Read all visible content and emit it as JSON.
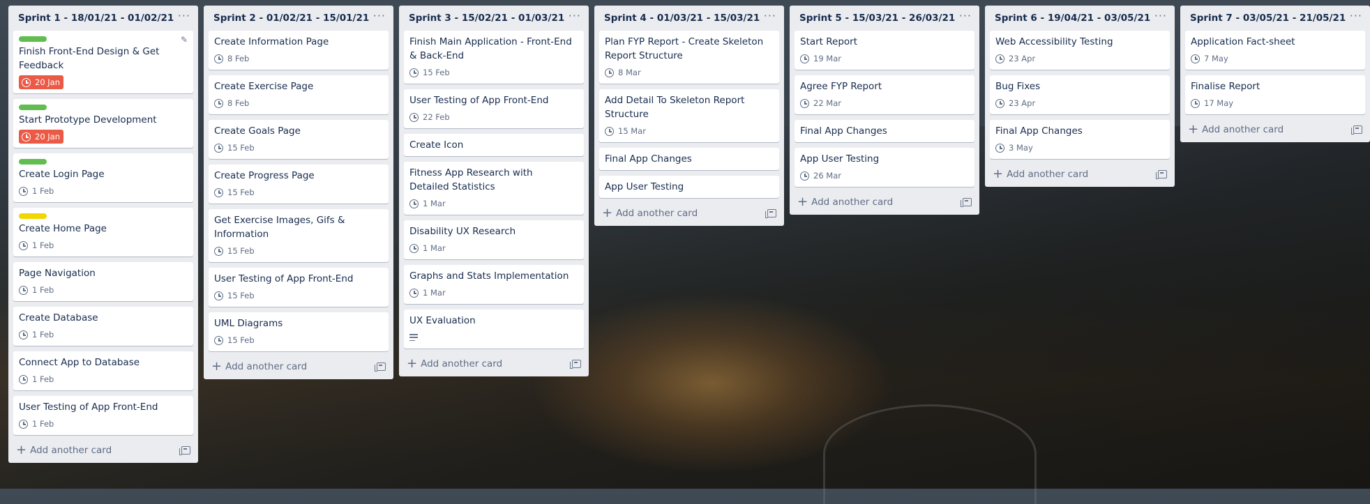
{
  "board": {
    "add_card_label": "Add another card",
    "lists": [
      {
        "title": "Sprint 1 - 18/01/21 - 01/02/21",
        "cards": [
          {
            "title": "Finish Front-End Design & Get Feedback",
            "label_color": "#61bd4f",
            "due": "20 Jan",
            "overdue": true,
            "editing": true
          },
          {
            "title": "Start Prototype Development",
            "label_color": "#61bd4f",
            "due": "20 Jan",
            "overdue": true
          },
          {
            "title": "Create Login Page",
            "label_color": "#61bd4f",
            "due": "1 Feb"
          },
          {
            "title": "Create Home Page",
            "label_color": "#f2d600",
            "due": "1 Feb"
          },
          {
            "title": "Page Navigation",
            "due": "1 Feb"
          },
          {
            "title": "Create Database",
            "due": "1 Feb"
          },
          {
            "title": "Connect App to Database",
            "due": "1 Feb"
          },
          {
            "title": "User Testing of App Front-End",
            "due": "1 Feb"
          }
        ]
      },
      {
        "title": "Sprint 2 - 01/02/21 - 15/01/21",
        "cards": [
          {
            "title": "Create Information Page",
            "due": "8 Feb"
          },
          {
            "title": "Create Exercise Page",
            "due": "8 Feb"
          },
          {
            "title": "Create Goals Page",
            "due": "15 Feb"
          },
          {
            "title": "Create Progress Page",
            "due": "15 Feb"
          },
          {
            "title": "Get Exercise Images, Gifs & Information",
            "due": "15 Feb"
          },
          {
            "title": "User Testing of App Front-End",
            "due": "15 Feb"
          },
          {
            "title": "UML Diagrams",
            "due": "15 Feb"
          }
        ]
      },
      {
        "title": "Sprint 3 - 15/02/21 - 01/03/21",
        "cards": [
          {
            "title": "Finish Main Application - Front-End & Back-End",
            "due": "15 Feb"
          },
          {
            "title": "User Testing of App Front-End",
            "due": "22 Feb"
          },
          {
            "title": "Create Icon"
          },
          {
            "title": "Fitness App Research with Detailed Statistics",
            "due": "1 Mar"
          },
          {
            "title": "Disability UX Research",
            "due": "1 Mar"
          },
          {
            "title": "Graphs and Stats Implementation",
            "due": "1 Mar"
          },
          {
            "title": "UX Evaluation",
            "has_description": true
          }
        ]
      },
      {
        "title": "Sprint 4 - 01/03/21 - 15/03/21",
        "cards": [
          {
            "title": "Plan FYP Report - Create Skeleton Report Structure",
            "due": "8 Mar"
          },
          {
            "title": "Add Detail To Skeleton Report Structure",
            "due": "15 Mar"
          },
          {
            "title": "Final App Changes"
          },
          {
            "title": "App User Testing"
          }
        ]
      },
      {
        "title": "Sprint 5 - 15/03/21 - 26/03/21",
        "cards": [
          {
            "title": "Start Report",
            "due": "19 Mar"
          },
          {
            "title": "Agree FYP Report",
            "due": "22 Mar"
          },
          {
            "title": "Final App Changes"
          },
          {
            "title": "App User Testing",
            "due": "26 Mar"
          }
        ]
      },
      {
        "title": "Sprint 6 - 19/04/21 - 03/05/21",
        "cards": [
          {
            "title": "Web Accessibility Testing",
            "due": "23 Apr"
          },
          {
            "title": "Bug Fixes",
            "due": "23 Apr"
          },
          {
            "title": "Final App Changes",
            "due": "3 May"
          }
        ]
      },
      {
        "title": "Sprint 7 - 03/05/21 - 21/05/21",
        "cards": [
          {
            "title": "Application Fact-sheet",
            "due": "7 May"
          },
          {
            "title": "Finalise Report",
            "due": "17 May"
          }
        ]
      }
    ]
  }
}
